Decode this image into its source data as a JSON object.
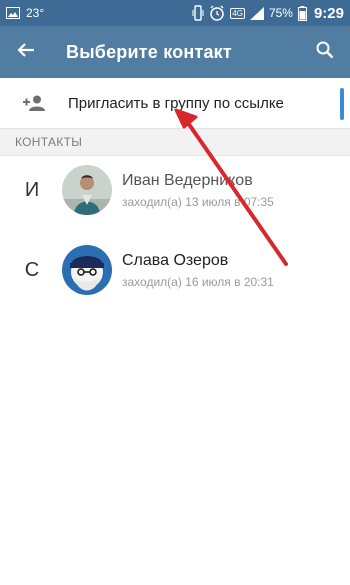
{
  "statusbar": {
    "temperature": "23°",
    "network": "4G",
    "battery": "75%",
    "time": "9:29"
  },
  "toolbar": {
    "title": "Выберите контакт",
    "back_icon": "arrow-back-icon",
    "search_icon": "search-icon"
  },
  "invite": {
    "label": "Пригласить в группу по ссылке",
    "icon": "person-add-icon"
  },
  "contacts_header": "КОНТАКТЫ",
  "contacts": [
    {
      "letter": "И",
      "name": "Иван Ведерников",
      "status": "заходил(а) 13 июля в 07:35"
    },
    {
      "letter": "С",
      "name": "Слава Озеров",
      "status": "заходил(а) 16 июля в 20:31"
    }
  ],
  "colors": {
    "statusbar": "#3e6b95",
    "toolbar": "#527da3",
    "annotation_arrow": "#d9272e",
    "scroll_thumb": "#3a8bd6"
  }
}
